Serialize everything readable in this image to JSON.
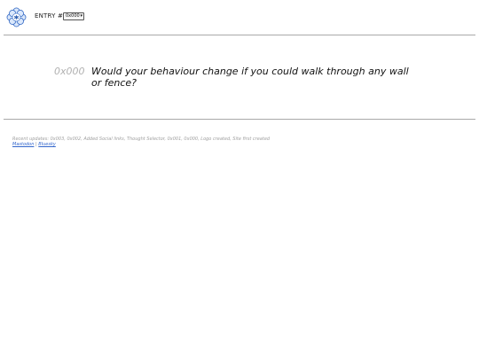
{
  "header": {
    "entry_label": "ENTRY #",
    "entry_selected": "0x000",
    "logo_icon": "flower-logo-icon",
    "accent_color": "#4a7fd4"
  },
  "thought": {
    "id": "0x000",
    "text": "Would your behaviour change if you could walk through any wall or fence?"
  },
  "footer": {
    "recent_updates": "Recent updates: 0x003, 0x002, Added Social links, Thought Selector, 0x001, 0x000, Logo created, Site first created",
    "links": [
      {
        "label": "Mastodon"
      },
      {
        "label": "Bluesky"
      }
    ],
    "separator": "|"
  }
}
